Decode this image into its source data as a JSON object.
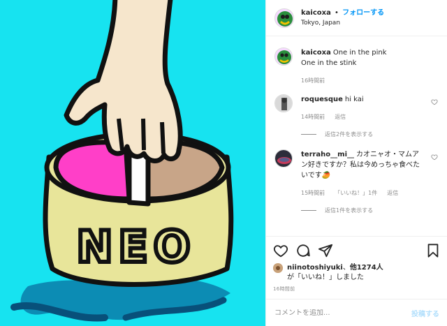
{
  "colors": {
    "accent": "#0095f6",
    "post_disabled": "#b2dffc",
    "muted": "#8e8e8e",
    "image_bg": "#17e3f0",
    "pink": "#ff3fc8",
    "tan": "#c8a588",
    "jar": "#e8e59a"
  },
  "image": {
    "jar_text": "NEO"
  },
  "header": {
    "username": "kaicoxa",
    "separator": "•",
    "follow_label": "フォローする",
    "location": "Tokyo, Japan"
  },
  "caption": {
    "username": "kaicoxa",
    "text_line1": "One in the pink",
    "text_line2": "One in the stink",
    "time": "16時間前"
  },
  "comments": [
    {
      "username": "roquesque",
      "text": "hi kai",
      "time": "14時間前",
      "reply_label": "返信",
      "replies_label": "返信2件を表示する"
    },
    {
      "username": "terraho__mi__",
      "text": "カオニャオ・マムアン好きですか？私は今めっちゃ食べたいです🥭",
      "time": "15時間前",
      "likes_label": "「いいね！」1件",
      "reply_label": "返信",
      "replies_label": "返信1件を表示する"
    }
  ],
  "actions": {
    "icons": [
      "heart-icon",
      "comment-icon",
      "share-icon",
      "bookmark-icon"
    ]
  },
  "likes": {
    "user": "niinotoshiyuki",
    "separator": "、",
    "others": "他1274人",
    "suffix": "が「いいね！」しました"
  },
  "post_time": "16時間前",
  "add_comment": {
    "placeholder": "コメントを追加...",
    "post_label": "投稿する"
  }
}
